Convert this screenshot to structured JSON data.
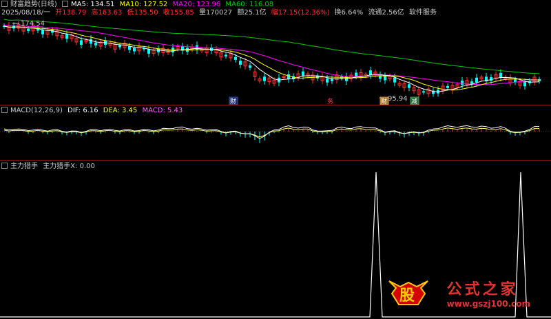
{
  "header": {
    "title": "财富趋势(日线)",
    "ma5": "MA5: 134.51",
    "ma10": "MA10: 127.52",
    "ma20": "MA20: 123.96",
    "ma60": "MA60: 116.08",
    "date": "2025/08/18/一",
    "open": "开138.79",
    "high": "高163.63",
    "low": "低135.50",
    "close": "收155.85",
    "volume": "量170027",
    "amount": "额25.1亿",
    "change": "幅17.15(12.36%)",
    "turnover": "换6.64%",
    "float": "流通2.56亿",
    "sector": "软件服务"
  },
  "price_chart": {
    "high_label": "174.54",
    "low_label": "95.94",
    "markers": [
      "财",
      "务",
      "财",
      "减"
    ]
  },
  "macd": {
    "label": "MACD(12,26,9)",
    "dif": "DIF: 6.16",
    "dea": "DEA: 3.45",
    "macd": "MACD: 5.43"
  },
  "zl": {
    "label": "主力猎手",
    "value": "主力猎手X: 0.00"
  },
  "watermark": {
    "logo_char": "股",
    "title": "公式之家",
    "url": "www.gszj100.com"
  },
  "colors": {
    "ma5": "#ffffff",
    "ma10": "#ffff00",
    "ma20": "#ff00ff",
    "ma60": "#00cc00",
    "up": "#ff3333",
    "down": "#00ffff",
    "macd_pos": "#ff3333",
    "macd_neg": "#00ffff",
    "separator": "#8b1a1a"
  }
}
